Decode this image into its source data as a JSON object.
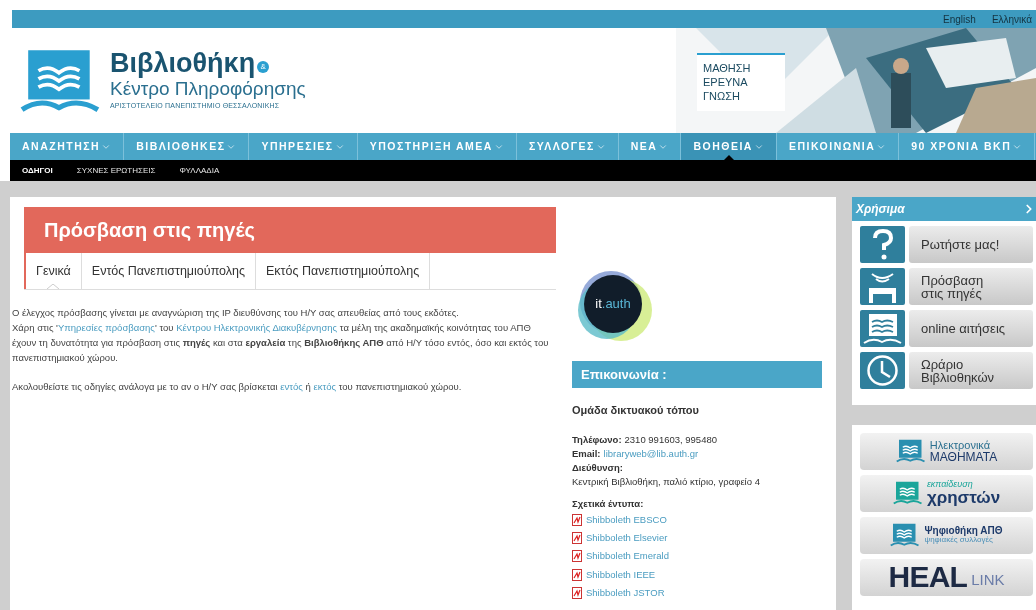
{
  "top_bar": {
    "languages": [
      "English",
      "Ελληνικά"
    ]
  },
  "header": {
    "logo_title": "Βιβλιοθήκη",
    "logo_ampersand": "&",
    "logo_subtitle": "Κέντρο Πληροφόρησης",
    "logo_university": "ΑΡΙΣΤΟΤΕΛΕΙΟ ΠΑΝΕΠΙΣΤΗΜΙΟ ΘΕΣΣΑΛΟΝΙΚΗΣ",
    "motto": [
      "ΜΑΘΗΣΗ",
      "ΕΡΕΥΝΑ",
      "ΓΝΩΣΗ"
    ]
  },
  "nav": [
    {
      "label": "ΑΝΑΖΗΤΗΣΗ",
      "selected": false
    },
    {
      "label": "ΒΙΒΛΙΟΘΗΚΕΣ",
      "selected": false
    },
    {
      "label": "ΥΠΗΡΕΣΙΕΣ",
      "selected": false
    },
    {
      "label": "ΥΠΟΣΤΗΡΙΞΗ ΑΜΕΑ",
      "selected": false
    },
    {
      "label": "ΣΥΛΛΟΓΕΣ",
      "selected": false
    },
    {
      "label": "ΝΕΑ",
      "selected": false
    },
    {
      "label": "ΒΟΗΘΕΙΑ",
      "selected": true
    },
    {
      "label": "ΕΠΙΚΟΙΝΩΝΙΑ",
      "selected": false
    },
    {
      "label": "90 ΧΡΟΝΙΑ ΒΚΠ",
      "selected": false
    }
  ],
  "subnav": [
    {
      "label": "ΟΔΗΓΟΙ",
      "selected": true
    },
    {
      "label": "ΣΥΧΝΕΣ ΕΡΩΤΗΣΕΙΣ",
      "selected": false
    },
    {
      "label": "ΦΥΛΛΑΔΙΑ",
      "selected": false
    }
  ],
  "page_title": "Πρόσβαση στις πηγές",
  "tabs": [
    {
      "label": "Γενικά",
      "selected": true
    },
    {
      "label": "Εντός Πανεπιστημιούπολης",
      "selected": false
    },
    {
      "label": "Εκτός Πανεπιστημιούπολης",
      "selected": false
    }
  ],
  "paragraphs": [
    [
      {
        "kind": "plain",
        "text": "Ο έλεγχος πρόσβασης γίνεται με αναγνώριση της IP διευθύνσης του Η/Υ σας απευθείας από τους εκδότες."
      },
      {
        "kind": "break"
      },
      {
        "kind": "plain",
        "text": "Χάρη στις '"
      },
      {
        "kind": "link",
        "text": "Υπηρεσίες πρόσβασης"
      },
      {
        "kind": "plain",
        "text": "' του "
      },
      {
        "kind": "link",
        "text": "Κέντρου Ηλεκτρονικής Διακυβέρνησης"
      },
      {
        "kind": "plain",
        "text": " τα μέλη της ακαδημαϊκής κοινότητας του ΑΠΘ έχουν τη δυνατότητα για πρόσβαση στις "
      },
      {
        "kind": "bold",
        "text": "πηγές"
      },
      {
        "kind": "plain",
        "text": " και στα "
      },
      {
        "kind": "bold",
        "text": "εργαλεία"
      },
      {
        "kind": "plain",
        "text": " της "
      },
      {
        "kind": "bold",
        "text": "Βιβλιοθήκης ΑΠΘ"
      },
      {
        "kind": "plain",
        "text": " από Η/Υ τόσο εντός, όσο και εκτός του πανεπιστημιακού χώρου."
      }
    ],
    [
      {
        "kind": "plain",
        "text": "Ακολουθείστε τις οδηγίες ανάλογα με το αν ο Η/Υ σας βρίσκεται "
      },
      {
        "kind": "link",
        "text": "εντός"
      },
      {
        "kind": "plain",
        "text": " ή "
      },
      {
        "kind": "link",
        "text": "εκτός"
      },
      {
        "kind": "plain",
        "text": " του πανεπιστημιακού χώρου."
      }
    ]
  ],
  "it_logo": {
    "prefix": "it",
    "suffix": ".auth"
  },
  "contact": {
    "title": "Επικοινωνία :",
    "team": "Ομάδα δικτυακού τόπου",
    "lines": [
      {
        "kind": "inline",
        "label": "Τηλέφωνο:",
        "value": "2310 991603, 995480"
      },
      {
        "kind": "link",
        "label": "Email:",
        "value": "libraryweb@lib.auth.gr"
      },
      {
        "kind": "block",
        "label": "Διεύθυνση:",
        "value": "Κεντρική Βιβλιοθήκη, παλιό κτίριο, γραφείο 4"
      }
    ],
    "docs_title": "Σχετικά έντυπα:",
    "docs": [
      "Shibboleth EBSCO",
      "Shibboleth Elsevier",
      "Shibboleth Emerald",
      "Shibboleth IEEE",
      "Shibboleth JSTOR"
    ]
  },
  "useful": {
    "title": "Χρήσιμα",
    "items": [
      {
        "kind": "question",
        "label": "Ρωτήστε μας!"
      },
      {
        "kind": "access",
        "label": "Πρόσβαση\nστις πηγές"
      },
      {
        "kind": "book",
        "label": "online αιτήσεις"
      },
      {
        "kind": "clock",
        "label": "Ωράριο\nΒιβλιοθηκών"
      }
    ]
  },
  "banners": [
    {
      "kind": "elearning",
      "line1": "Ηλεκτρονικά",
      "line2": "ΜΑΘΗΜΑΤΑ"
    },
    {
      "kind": "training",
      "line1": "εκπαίδευση",
      "line2": "χρηστών"
    },
    {
      "kind": "repository",
      "line1": "Ψηφιοθήκη ΑΠΘ",
      "line2": "ψηφιακές συλλογές"
    },
    {
      "kind": "heal",
      "line1": "HEAL",
      "line2": "LINK"
    }
  ]
}
